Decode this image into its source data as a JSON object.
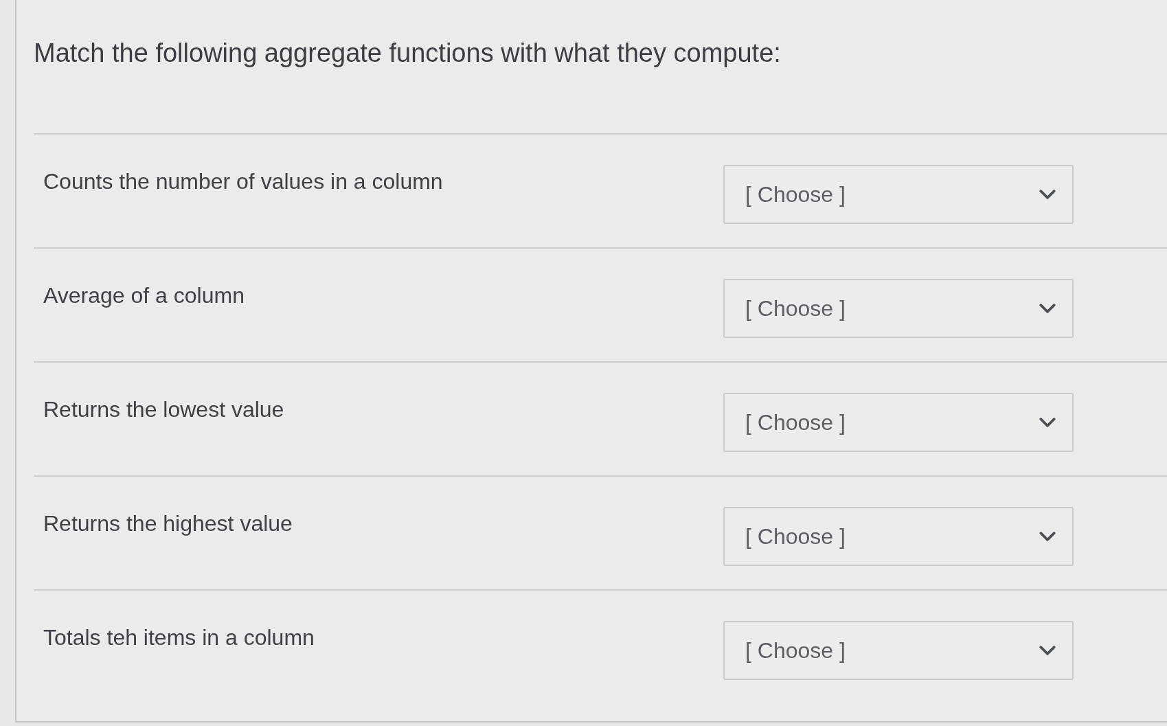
{
  "question": {
    "prompt": "Match the following aggregate functions with what they compute:"
  },
  "pairs": [
    {
      "statement": "Counts the number of values in a column",
      "answer": {
        "placeholder": "[ Choose ]"
      }
    },
    {
      "statement": "Average of a column",
      "answer": {
        "placeholder": "[ Choose ]"
      }
    },
    {
      "statement": "Returns the lowest value",
      "answer": {
        "placeholder": "[ Choose ]"
      }
    },
    {
      "statement": "Returns the highest value",
      "answer": {
        "placeholder": "[ Choose ]"
      }
    },
    {
      "statement": "Totals teh items in a column",
      "answer": {
        "placeholder": "[ Choose ]"
      }
    }
  ]
}
